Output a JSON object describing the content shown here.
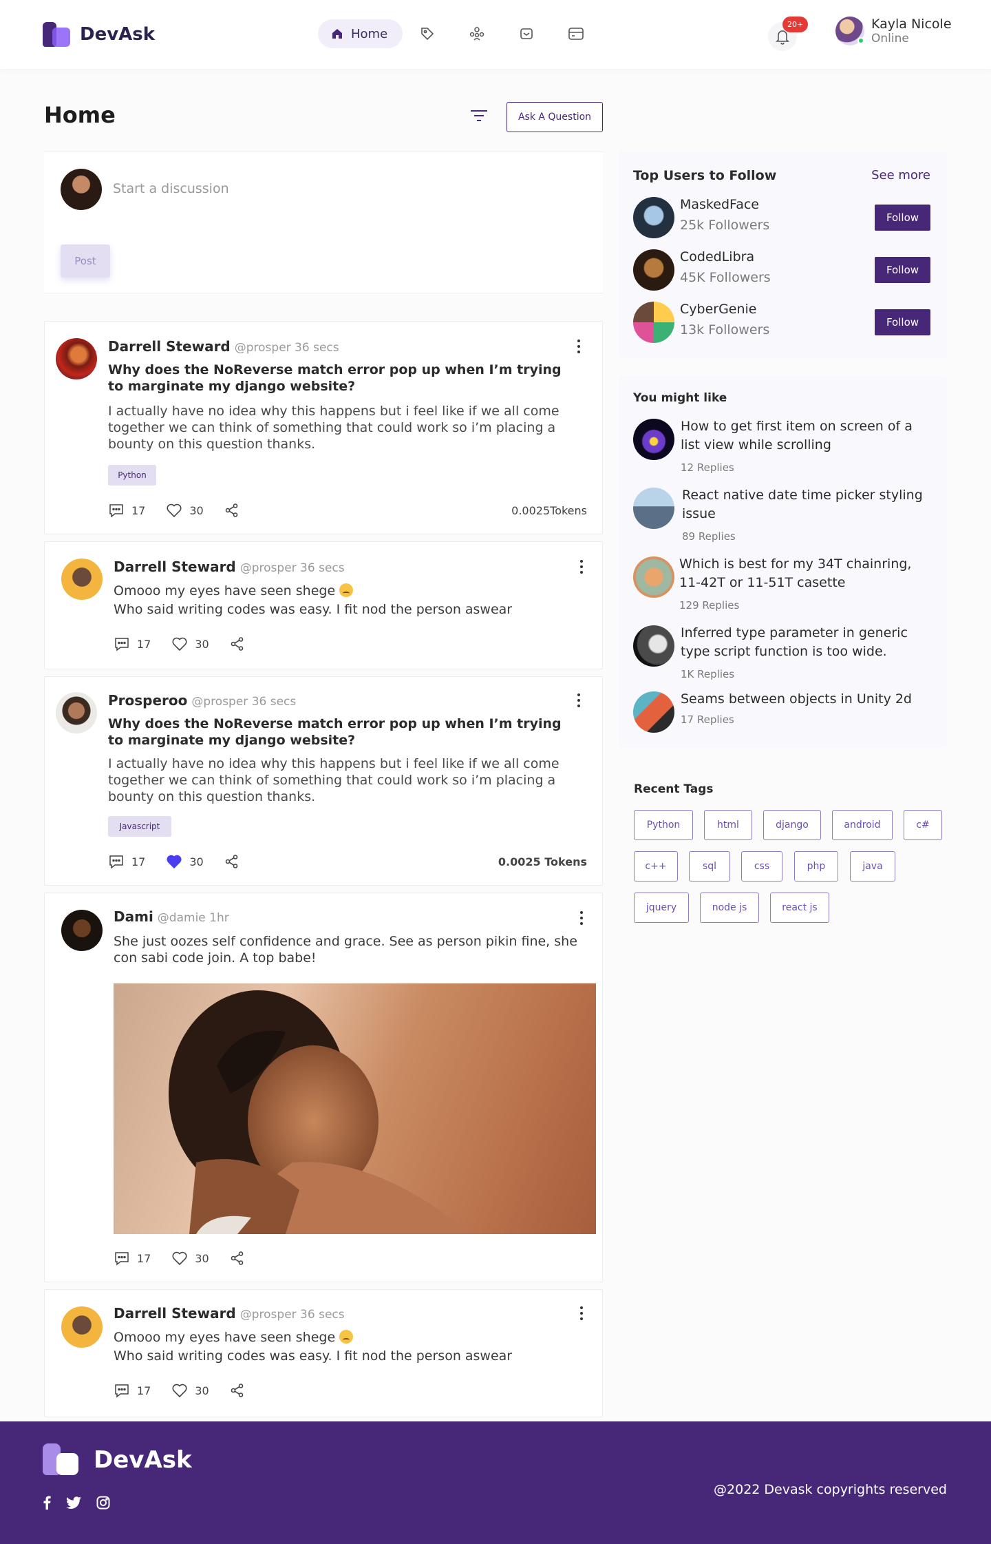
{
  "header": {
    "brand": "DevAsk",
    "nav_home": "Home",
    "notif_badge": "20+",
    "user_name": "Kayla Nicole",
    "user_status": "Online"
  },
  "main": {
    "title": "Home",
    "ask_button": "Ask A Question",
    "composer_placeholder": "Start a discussion",
    "post_button": "Post"
  },
  "posts": [
    {
      "author": "Darrell Steward",
      "handle": "@prosper 36 secs",
      "title": "Why does the NoReverse match error pop up when I’m trying to marginate my django website?",
      "body": "I actually have no idea why this happens but i feel like if we all come together we can think of something that could work so i’m placing a bounty on this question thanks.",
      "tag": "Python",
      "comments": "17",
      "likes": "30",
      "tokens": "0.0025Tokens",
      "liked": false
    },
    {
      "author": "Darrell Steward",
      "handle": "@prosper 36 secs",
      "line1": "Omooo my eyes have seen shege",
      "line2": "Who said writing codes was easy. I fit nod the person aswear",
      "comments": "17",
      "likes": "30"
    },
    {
      "author": "Prosperoo",
      "handle": "@prosper 36 secs",
      "title": "Why does the NoReverse match error pop up when I’m trying to marginate my django website?",
      "body": "I actually have no idea why this happens but i feel like if we all come together we can think of something that could work so i’m placing a bounty on this question thanks.",
      "tag": "Javascript",
      "comments": "17",
      "likes": "30",
      "tokens": "0.0025 Tokens",
      "liked": true
    },
    {
      "author": "Dami",
      "handle": "@damie  1hr",
      "body": "She just oozes self confidence and grace. See as person pikin fine, she con sabi code join. A top babe!",
      "comments": "17",
      "likes": "30"
    },
    {
      "author": "Darrell Steward",
      "handle": "@prosper 36 secs",
      "line1": "Omooo my eyes have seen shege",
      "line2": "Who said writing codes was easy. I fit nod the person aswear",
      "comments": "17",
      "likes": "30"
    }
  ],
  "top_users": {
    "title": "Top Users to Follow",
    "see_more": "See more",
    "follow_label": "Follow",
    "users": [
      {
        "name": "MaskedFace",
        "followers": "25k Followers"
      },
      {
        "name": "CodedLibra",
        "followers": "45K Followers"
      },
      {
        "name": "CyberGenie",
        "followers": "13k Followers"
      }
    ]
  },
  "might_like": {
    "title": "You might like",
    "items": [
      {
        "title": "How to get first item on screen of a list view while scrolling",
        "replies": "12 Replies"
      },
      {
        "title": "React native date  time picker styling issue",
        "replies": "89 Replies"
      },
      {
        "title": "Which is best for my 34T chainring, 11-42T or 11-51T casette",
        "replies": "129 Replies"
      },
      {
        "title": "Inferred type parameter in generic type script function is too wide.",
        "replies": "1K Replies"
      },
      {
        "title": "Seams between objects in Unity 2d",
        "replies": "17 Replies"
      }
    ]
  },
  "recent_tags": {
    "title": "Recent Tags",
    "tags": [
      "Python",
      "html",
      "django",
      "android",
      "c#",
      "c++",
      "sql",
      "css",
      "php",
      "java",
      "jquery",
      "node js",
      "react js"
    ]
  },
  "footer": {
    "brand": "DevAsk",
    "copyright": "@2022 Devask copyrights reserved"
  },
  "colors": {
    "brand": "#472878",
    "brand_light": "#e4def2",
    "like_active": "#4a3ff0",
    "badge": "#e53935"
  }
}
